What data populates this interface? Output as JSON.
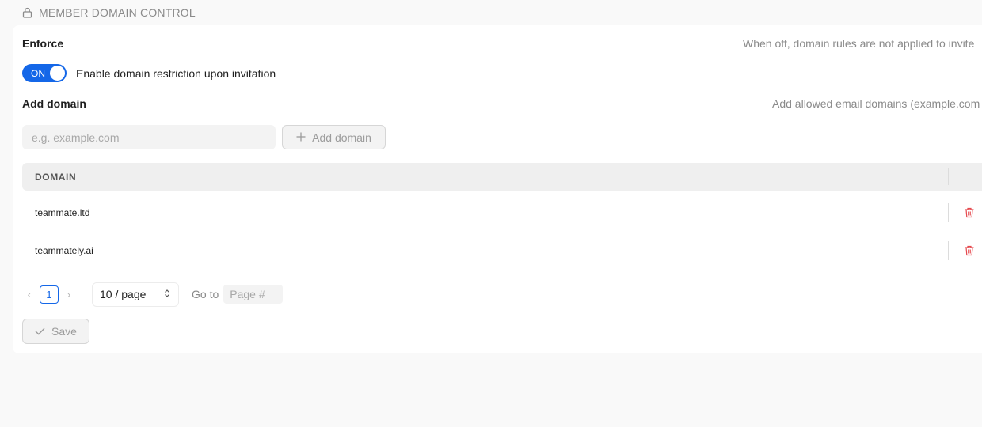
{
  "section": {
    "title": "MEMBER DOMAIN CONTROL",
    "icon": "lock-icon"
  },
  "enforce": {
    "title": "Enforce",
    "hint": "When off, domain rules are not applied to invite",
    "toggle_state": "ON",
    "toggle_label": "Enable domain restriction upon invitation"
  },
  "add_domain": {
    "title": "Add domain",
    "hint": "Add allowed email domains (example.com",
    "placeholder": "e.g. example.com",
    "button_label": "Add domain"
  },
  "table": {
    "header": "DOMAIN",
    "rows": [
      {
        "domain": "teammate.ltd"
      },
      {
        "domain": "teammately.ai"
      }
    ]
  },
  "pagination": {
    "current_page": "1",
    "per_page": "10 / page",
    "goto_label": "Go to",
    "goto_placeholder": "Page #"
  },
  "save": {
    "label": "Save"
  },
  "colors": {
    "accent": "#1467e8",
    "danger": "#e5484d",
    "muted": "#8a8a8a"
  }
}
